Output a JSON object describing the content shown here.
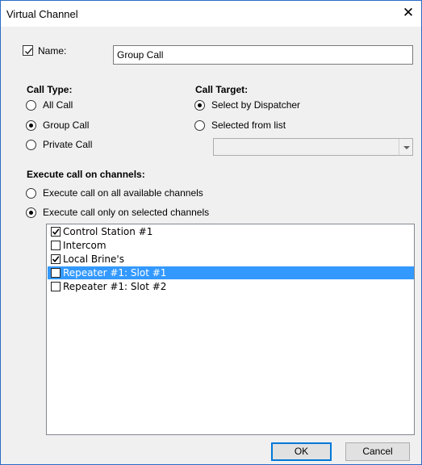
{
  "window": {
    "title": "Virtual Channel",
    "close_glyph": "✕"
  },
  "name": {
    "checkbox_label": "Name:",
    "checked": true,
    "value": "Group Call"
  },
  "call_type": {
    "heading": "Call Type:",
    "options": [
      {
        "label": "All Call",
        "selected": false
      },
      {
        "label": "Group Call",
        "selected": true
      },
      {
        "label": "Private Call",
        "selected": false
      }
    ]
  },
  "call_target": {
    "heading": "Call Target:",
    "options": [
      {
        "label": "Select by Dispatcher",
        "selected": true
      },
      {
        "label": "Selected from list",
        "selected": false
      }
    ],
    "list_select_value": ""
  },
  "execute": {
    "heading": "Execute call on channels:",
    "options": [
      {
        "label": "Execute call on all available channels",
        "selected": false
      },
      {
        "label": "Execute call only on selected channels",
        "selected": true
      }
    ]
  },
  "channels": [
    {
      "label": "Control Station #1",
      "checked": true,
      "highlighted": false
    },
    {
      "label": "Intercom",
      "checked": false,
      "highlighted": false
    },
    {
      "label": "Local Brine's",
      "checked": true,
      "highlighted": false
    },
    {
      "label": "Repeater #1: Slot #1",
      "checked": false,
      "highlighted": true
    },
    {
      "label": "Repeater #1: Slot #2",
      "checked": false,
      "highlighted": false
    }
  ],
  "buttons": {
    "ok": "OK",
    "cancel": "Cancel"
  }
}
